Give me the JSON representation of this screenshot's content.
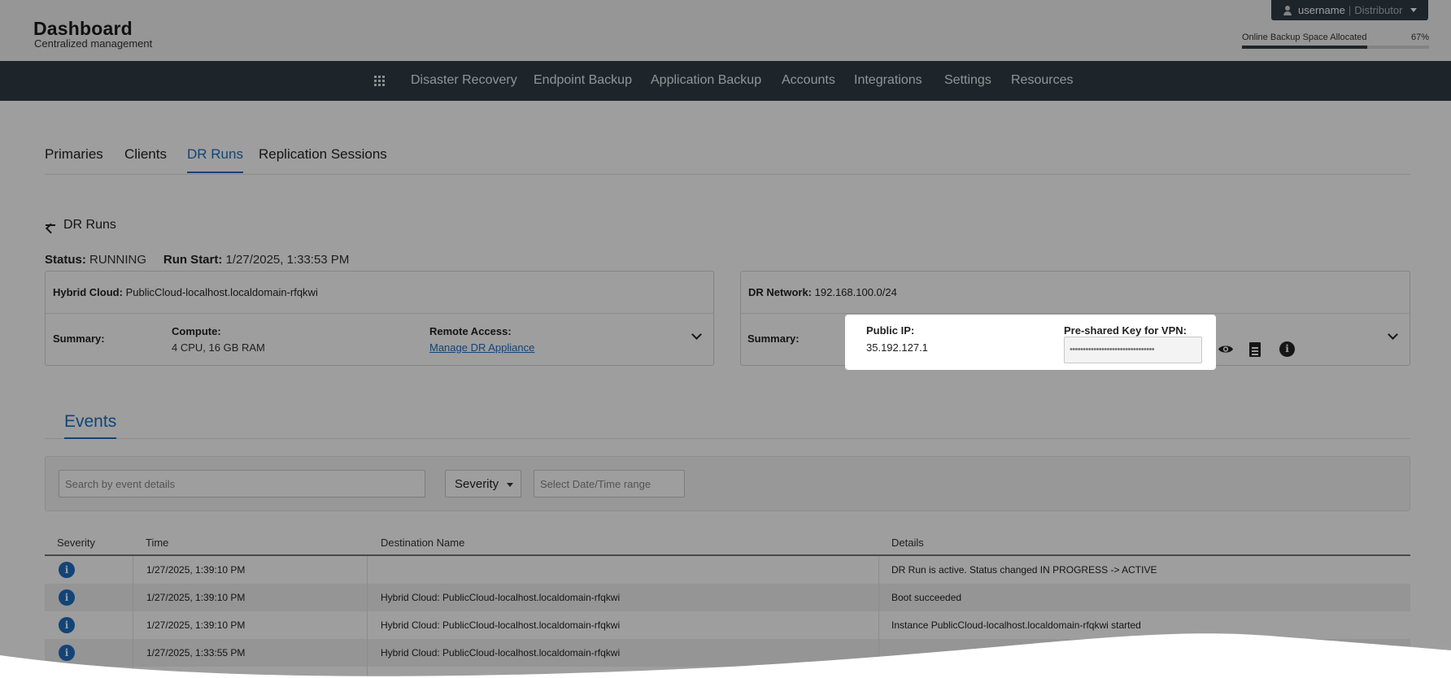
{
  "header": {
    "title": "Dashboard",
    "subtitle": "Centralized management",
    "user": {
      "name": "username",
      "separator": "|",
      "role": "Distributor"
    },
    "storage": {
      "label": "Online Backup Space Allocated",
      "percent_text": "67%",
      "percent": 67
    }
  },
  "nav": {
    "items": [
      "Disaster Recovery",
      "Endpoint Backup",
      "Application Backup",
      "Accounts",
      "Integrations",
      "Settings",
      "Resources"
    ]
  },
  "subtabs": [
    "Primaries",
    "Clients",
    "DR Runs",
    "Replication Sessions"
  ],
  "back_label": "DR Runs",
  "status": {
    "status_label": "Status:",
    "status_value": "RUNNING",
    "start_label": "Run Start:",
    "start_value": "1/27/2025, 1:33:53 PM"
  },
  "left_panel": {
    "header_label": "Hybrid Cloud:",
    "header_value": "PublicCloud-localhost.localdomain-rfqkwi",
    "summary_label": "Summary:",
    "compute_label": "Compute:",
    "compute_value": "4 CPU, 16 GB RAM",
    "remote_label": "Remote Access:",
    "remote_link": "Manage DR Appliance"
  },
  "right_panel": {
    "header_label": "DR Network:",
    "header_value": "192.168.100.0/24",
    "summary_label": "Summary:"
  },
  "popup": {
    "ip_label": "Public IP:",
    "ip_value": "35.192.127.1",
    "psk_label": "Pre-shared Key for VPN:",
    "psk_masked": "••••••••••••••••••••••••••••••••"
  },
  "events": {
    "tab": "Events",
    "search_placeholder": "Search by event details",
    "severity_label": "Severity",
    "date_placeholder": "Select Date/Time range",
    "columns": [
      "Severity",
      "Time",
      "Destination Name",
      "Details"
    ],
    "rows": [
      {
        "time": "1/27/2025, 1:39:10 PM",
        "destination": "",
        "details": "DR Run is active. Status changed IN PROGRESS -> ACTIVE"
      },
      {
        "time": "1/27/2025, 1:39:10 PM",
        "destination": "Hybrid Cloud: PublicCloud-localhost.localdomain-rfqkwi",
        "details": "Boot succeeded"
      },
      {
        "time": "1/27/2025, 1:39:10 PM",
        "destination": "Hybrid Cloud: PublicCloud-localhost.localdomain-rfqkwi",
        "details": "Instance PublicCloud-localhost.localdomain-rfqkwi started"
      },
      {
        "time": "1/27/2025, 1:33:55 PM",
        "destination": "Hybrid Cloud: PublicCloud-localhost.localdomain-rfqkwi",
        "details": ""
      }
    ]
  },
  "colors": {
    "accent": "#1e6fc1",
    "nav_bg": "#2f3d45"
  }
}
